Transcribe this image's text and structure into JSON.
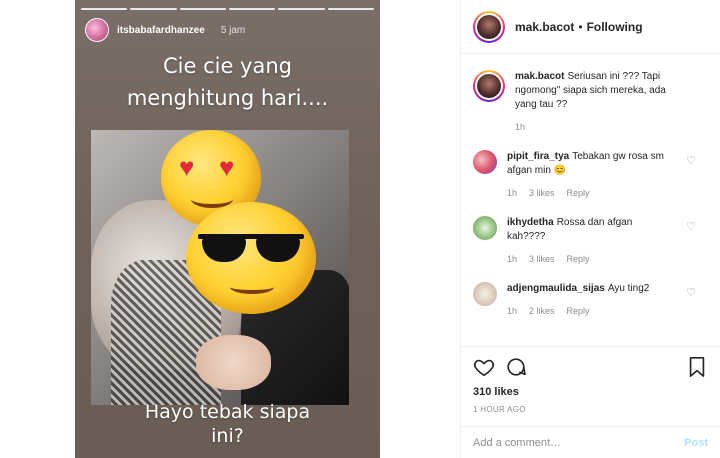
{
  "story": {
    "username": "itsbabafardhanzee",
    "time": "5 jam",
    "caption_line1": "Cie cie yang",
    "caption_line2": "menghitung hari....",
    "bottom_line1": "Hayo tebak siapa",
    "bottom_line2": "ini?"
  },
  "post_header": {
    "username": "mak.bacot",
    "separator": "•",
    "follow_status": "Following"
  },
  "comments": [
    {
      "user": "mak.bacot",
      "text": "Seriusan ini ??? Tapi ngomong\" siapa sich mereka, ada yang tau ??",
      "age": "1h",
      "likes": "",
      "reply": ""
    },
    {
      "user": "pipit_fira_tya",
      "text": "Tebakan gw rosa sm afgan min 😊",
      "age": "1h",
      "likes": "3 likes",
      "reply": "Reply"
    },
    {
      "user": "ikhydetha",
      "text": "Rossa dan afgan kah????",
      "age": "1h",
      "likes": "3 likes",
      "reply": "Reply"
    },
    {
      "user": "adjengmaulida_sijas",
      "text": "Ayu ting2",
      "age": "1h",
      "likes": "2 likes",
      "reply": "Reply"
    }
  ],
  "likes_count": "310 likes",
  "posted_ago": "1 HOUR AGO",
  "add_comment": {
    "placeholder": "Add a comment…",
    "post_label": "Post"
  },
  "icons": {
    "like": "heart-icon",
    "comment": "comment-bubble-icon",
    "save": "bookmark-icon"
  }
}
